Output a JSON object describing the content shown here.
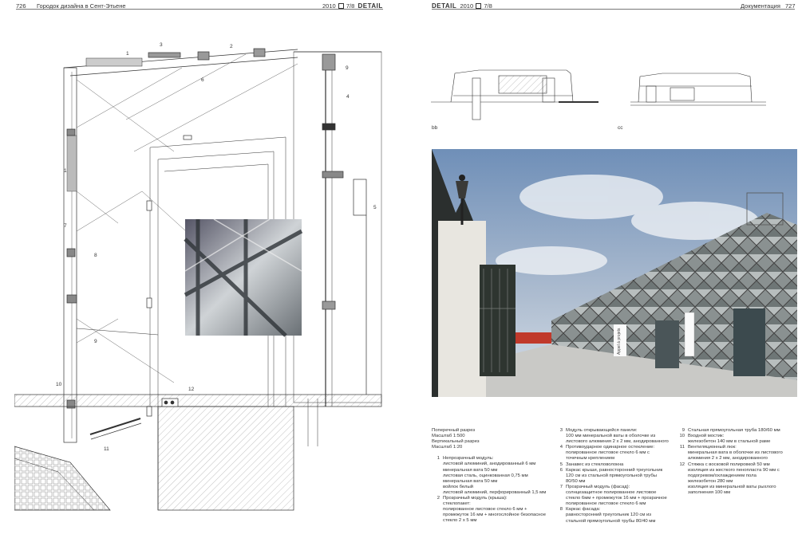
{
  "header": {
    "left_page_number": "726",
    "left_title": "Городок дизайна в Сент-Этьене",
    "left_issue": "2010",
    "left_issue_num": "7/8",
    "left_brand": "DETAIL",
    "right_brand": "DETAIL",
    "right_issue": "2010",
    "right_issue_num": "7/8",
    "right_section": "Документация",
    "right_page_number": "727"
  },
  "drawing": {
    "callouts": [
      "1",
      "2",
      "3",
      "4",
      "5",
      "6",
      "7",
      "8",
      "9",
      "10",
      "11",
      "12"
    ]
  },
  "sections": {
    "label_bb": "bb",
    "label_cc": "cc"
  },
  "captions": {
    "intro": "Поперечный разрез\nМасштаб 1:500\nВертикальный разрез\nМасштаб 1:20",
    "col1": [
      {
        "n": "1",
        "t": "Непрозрачный модуль:\nлистовой алюминий, анодированный 6 мм\nминеральная вата 50 мм\nлистовая сталь, оцинкованная 0,75 мм\nминеральная вата 50 мм\nвойлок белый\nлистовой алюминий, перфорированный 1,5 мм"
      },
      {
        "n": "2",
        "t": "Прозрачный модуль (крыша):\nстеклопакет:\nполированное листовое стекло 6 мм +\nпромежуток 16 мм + многослойное безопасное\nстекло 2 x 5 мм"
      }
    ],
    "col2": [
      {
        "n": "3",
        "t": "Модуль открывающейся панели:\n100 мм минеральной ваты в оболочке из\nлистового алюминия 2 x 2 мм, анодированного"
      },
      {
        "n": "4",
        "t": "Противоударное одинарное остекление:\nполированное листовое стекло 6 мм с\nточечным креплением"
      },
      {
        "n": "5",
        "t": "Занавес из стекловолокна"
      },
      {
        "n": "6",
        "t": "Каркас крыши, равносторонний треугольник\n120 см из стальной прямоугольной трубы\n80/50 мм"
      },
      {
        "n": "7",
        "t": "Прозрачный модуль (фасад):\nсолнцезащитное полированное листовое\nстекло 6мм + промежуток 16 мм + прозрачное\nполированное листовое стекло 6 мм"
      },
      {
        "n": "8",
        "t": "Каркас фасада:\nравносторонний треугольник 120 см из\nстальной прямоугольной трубы 80/40 мм"
      }
    ],
    "col3": [
      {
        "n": "9",
        "t": "Стальная прямоугольная труба 180/60 мм"
      },
      {
        "n": "10",
        "t": "Входной мостик:\nжелезобетон 140 мм в стальной раме"
      },
      {
        "n": "11",
        "t": "Вентиляционный люк:\nминеральная вата в оболочке из листового\nалюминия 2 x 2 мм, анодированного"
      },
      {
        "n": "12",
        "t": "Стяжка с восковой полировкой 50 мм\nизоляция из жесткого пенопласта 90 мм с\nподогревом/охлаждением пола\nжелезобетон 280 мм\nизоляция из минеральной ваты рыхлого\nзаполнения 100 мм"
      }
    ]
  },
  "photo": {
    "sign_text": "Appel à projets"
  },
  "colors": {
    "sky_top": "#6f8fb8",
    "sky_bottom": "#d9e1ea",
    "ground": "#c9c9c6",
    "facade": "#8a9191",
    "red_fence": "#c0392b"
  }
}
